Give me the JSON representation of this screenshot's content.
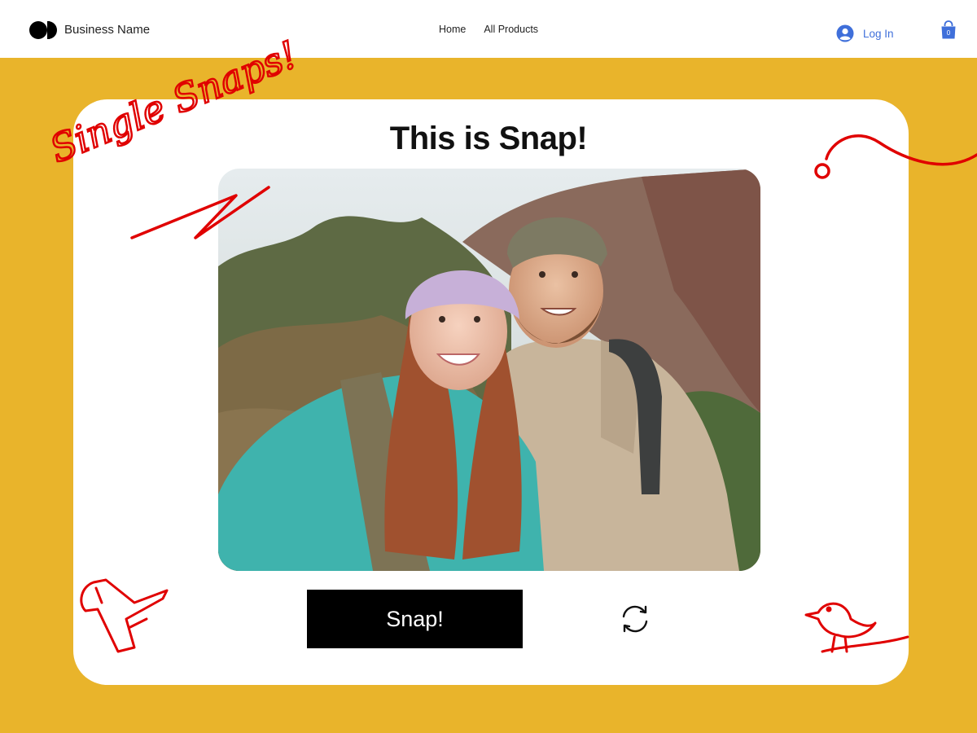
{
  "header": {
    "brand": "Business Name",
    "nav": [
      "Home",
      "All Products"
    ],
    "login_label": "Log In",
    "cart_count": "0"
  },
  "main": {
    "title": "This is Snap!",
    "snap_label": "Snap!",
    "photo_alt": "Smiling couple in hats taking a selfie outdoors"
  },
  "doodle_text": "Single Snaps!",
  "colors": {
    "background": "#E9B42B",
    "card": "#FFFFFF",
    "button": "#000000",
    "doodle": "#E00000",
    "link": "#3F6FDA"
  },
  "icons": [
    "logo-icon",
    "user-avatar-icon",
    "shopping-bag-icon",
    "refresh-icon"
  ]
}
